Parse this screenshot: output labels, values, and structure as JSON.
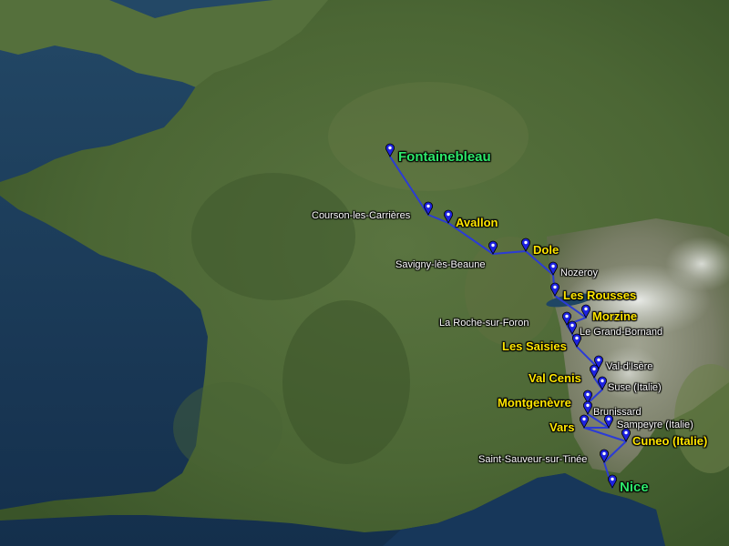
{
  "colors": {
    "sea": "#1a3a5c",
    "land_green": "#4f6a36",
    "land_dark": "#34502a",
    "mountain": "#8a8a7a",
    "snow": "#e8ece8",
    "route": "#2b3bd6",
    "pin": "#1d22e0",
    "label_small": "#ffffff",
    "label_medium": "#ffe600",
    "label_large": "#2ee86a"
  },
  "stops": [
    {
      "id": "fontainebleau",
      "name": "Fontainebleau",
      "style": "large"
    },
    {
      "id": "courson",
      "name": "Courson-les-Carrières",
      "style": "small"
    },
    {
      "id": "avallon",
      "name": "Avallon",
      "style": "medium"
    },
    {
      "id": "savigny",
      "name": "Savigny-lès-Beaune",
      "style": "small"
    },
    {
      "id": "dole",
      "name": "Dole",
      "style": "medium"
    },
    {
      "id": "nozeroy",
      "name": "Nozeroy",
      "style": "small"
    },
    {
      "id": "les-rousses",
      "name": "Les Rousses",
      "style": "medium"
    },
    {
      "id": "morzine",
      "name": "Morzine",
      "style": "medium"
    },
    {
      "id": "la-roche",
      "name": "La Roche-sur-Foron",
      "style": "small"
    },
    {
      "id": "grand-bornand",
      "name": "Le Grand-Bornand",
      "style": "small"
    },
    {
      "id": "les-saisies",
      "name": "Les Saisies",
      "style": "medium"
    },
    {
      "id": "val-disere",
      "name": "Val-d'Isère",
      "style": "small"
    },
    {
      "id": "val-cenis",
      "name": "Val Cenis",
      "style": "medium"
    },
    {
      "id": "suse",
      "name": "Suse (Italie)",
      "style": "small"
    },
    {
      "id": "montgenevre",
      "name": "Montgenèvre",
      "style": "medium"
    },
    {
      "id": "brunissard",
      "name": "Brunissard",
      "style": "small"
    },
    {
      "id": "sampeyre",
      "name": "Sampeyre (Italie)",
      "style": "small"
    },
    {
      "id": "vars",
      "name": "Vars",
      "style": "medium"
    },
    {
      "id": "cuneo",
      "name": "Cuneo (Italie)",
      "style": "medium"
    },
    {
      "id": "saint-sauveur",
      "name": "Saint-Sauveur-sur-Tinée",
      "style": "small"
    },
    {
      "id": "nice",
      "name": "Nice",
      "style": "large"
    }
  ]
}
